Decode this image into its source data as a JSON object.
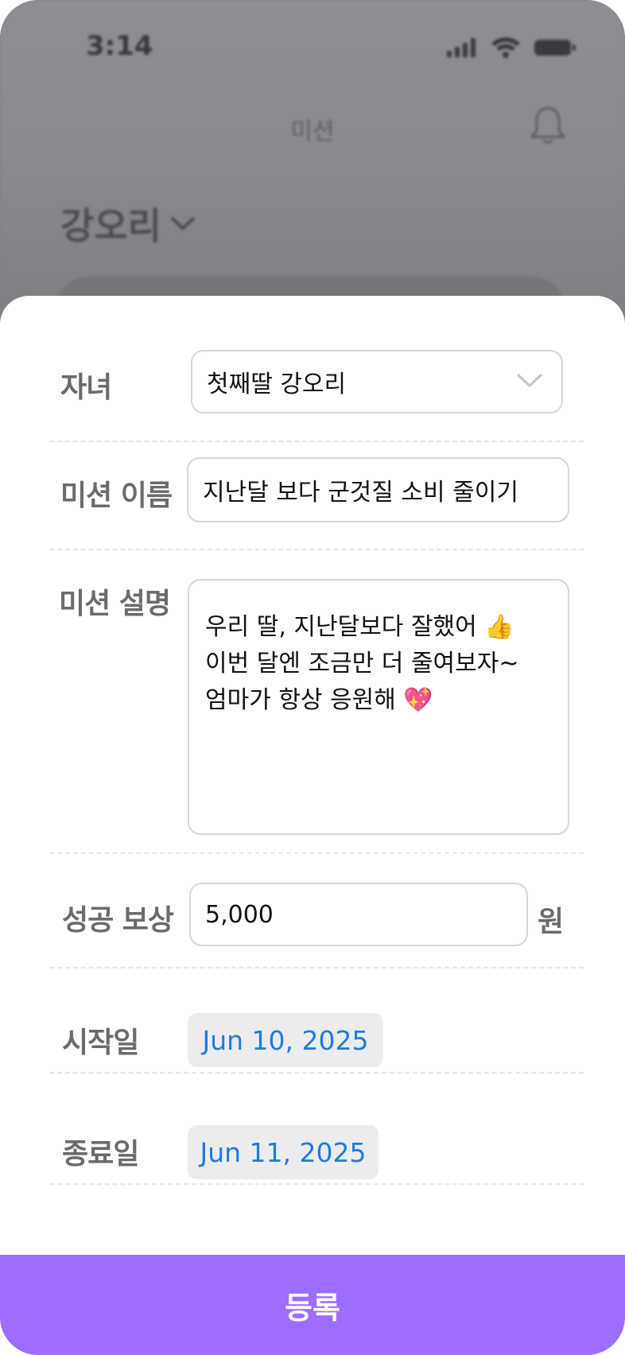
{
  "status_bar": {
    "time": "3:14"
  },
  "background": {
    "title": "미션",
    "child_name": "강오리"
  },
  "form": {
    "child": {
      "label": "자녀",
      "value": "첫째딸 강오리"
    },
    "mission_name": {
      "label": "미션 이름",
      "value": "지난달 보다 군것질 소비 줄이기"
    },
    "mission_desc": {
      "label": "미션 설명",
      "lines": [
        "우리 딸, 지난달보다 잘했어 👍",
        "이번 달엔 조금만 더 줄여보자~",
        "엄마가 항상 응원해 💖"
      ]
    },
    "reward": {
      "label": "성공 보상",
      "value": "5,000",
      "unit": "원"
    },
    "start_date": {
      "label": "시작일",
      "value": "Jun 10, 2025"
    },
    "end_date": {
      "label": "종료일",
      "value": "Jun 11, 2025"
    }
  },
  "submit_label": "등록",
  "colors": {
    "accent": "#9c6dff",
    "date_text": "#1f7ae0",
    "label": "#6b6b6e"
  },
  "icons": [
    "signal-icon",
    "wifi-icon",
    "battery-icon",
    "bell-icon",
    "chevron-down-icon"
  ]
}
